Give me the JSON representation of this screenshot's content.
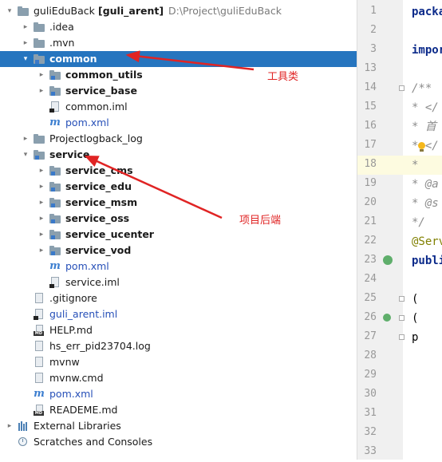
{
  "tree": {
    "rows": [
      {
        "level": 0,
        "arrow": "▾",
        "icon": "folder",
        "label": "guliEduBack",
        "extra_module": "[guli_arent]",
        "extra_path": "D:\\Project\\guliEduBack",
        "bold": false,
        "blue": false
      },
      {
        "level": 1,
        "arrow": "▸",
        "icon": "folder",
        "label": ".idea",
        "bold": false,
        "blue": false
      },
      {
        "level": 1,
        "arrow": "▸",
        "icon": "folder",
        "label": ".mvn",
        "bold": false,
        "blue": false
      },
      {
        "level": 1,
        "arrow": "▾",
        "icon": "module-folder",
        "label": "common",
        "bold": true,
        "blue": false,
        "selected": true
      },
      {
        "level": 2,
        "arrow": "▸",
        "icon": "module-folder",
        "label": "common_utils",
        "bold": true,
        "blue": false
      },
      {
        "level": 2,
        "arrow": "▸",
        "icon": "module-folder",
        "label": "service_base",
        "bold": true,
        "blue": false
      },
      {
        "level": 2,
        "arrow": "",
        "icon": "iml-file",
        "label": "common.iml",
        "bold": false,
        "blue": false
      },
      {
        "level": 2,
        "arrow": "",
        "icon": "maven",
        "label": "pom.xml",
        "bold": false,
        "blue": true
      },
      {
        "level": 1,
        "arrow": "▸",
        "icon": "folder",
        "label": "Projectlogback_log",
        "bold": false,
        "blue": false
      },
      {
        "level": 1,
        "arrow": "▾",
        "icon": "module-folder",
        "label": "service",
        "bold": true,
        "blue": false
      },
      {
        "level": 2,
        "arrow": "▸",
        "icon": "module-folder",
        "label": "service_cms",
        "bold": true,
        "blue": false
      },
      {
        "level": 2,
        "arrow": "▸",
        "icon": "module-folder",
        "label": "service_edu",
        "bold": true,
        "blue": false
      },
      {
        "level": 2,
        "arrow": "▸",
        "icon": "module-folder",
        "label": "service_msm",
        "bold": true,
        "blue": false
      },
      {
        "level": 2,
        "arrow": "▸",
        "icon": "module-folder",
        "label": "service_oss",
        "bold": true,
        "blue": false
      },
      {
        "level": 2,
        "arrow": "▸",
        "icon": "module-folder",
        "label": "service_ucenter",
        "bold": true,
        "blue": false
      },
      {
        "level": 2,
        "arrow": "▸",
        "icon": "module-folder",
        "label": "service_vod",
        "bold": true,
        "blue": false
      },
      {
        "level": 2,
        "arrow": "",
        "icon": "maven",
        "label": "pom.xml",
        "bold": false,
        "blue": true
      },
      {
        "level": 2,
        "arrow": "",
        "icon": "iml-file",
        "label": "service.iml",
        "bold": false,
        "blue": false
      },
      {
        "level": 1,
        "arrow": "",
        "icon": "file",
        "label": ".gitignore",
        "bold": false,
        "blue": false
      },
      {
        "level": 1,
        "arrow": "",
        "icon": "iml-file",
        "label": "guli_arent.iml",
        "bold": false,
        "blue": true
      },
      {
        "level": 1,
        "arrow": "",
        "icon": "md-file",
        "label": "HELP.md",
        "bold": false,
        "blue": false
      },
      {
        "level": 1,
        "arrow": "",
        "icon": "file",
        "label": "hs_err_pid23704.log",
        "bold": false,
        "blue": false
      },
      {
        "level": 1,
        "arrow": "",
        "icon": "file",
        "label": "mvnw",
        "bold": false,
        "blue": false
      },
      {
        "level": 1,
        "arrow": "",
        "icon": "file",
        "label": "mvnw.cmd",
        "bold": false,
        "blue": false
      },
      {
        "level": 1,
        "arrow": "",
        "icon": "maven",
        "label": "pom.xml",
        "bold": false,
        "blue": true
      },
      {
        "level": 1,
        "arrow": "",
        "icon": "md-file",
        "label": "READEME.md",
        "bold": false,
        "blue": false
      },
      {
        "level": 0,
        "arrow": "▸",
        "icon": "libraries",
        "label": "External Libraries",
        "bold": false,
        "blue": false
      },
      {
        "level": 0,
        "arrow": "",
        "icon": "scratches",
        "label": "Scratches and Consoles",
        "bold": false,
        "blue": false
      }
    ]
  },
  "annotations": {
    "common_note": "工具类",
    "service_note": "项目后端"
  },
  "editor": {
    "line_numbers": [
      "1",
      "2",
      "3",
      "13",
      "14",
      "15",
      "16",
      "17",
      "18",
      "19",
      "20",
      "21",
      "22",
      "23",
      "24",
      "25",
      "26",
      "27",
      "28",
      "29",
      "30",
      "31",
      "32",
      "33"
    ],
    "code": [
      "packa",
      "",
      "impor",
      "",
      "/**",
      " * </",
      " * 首",
      " * </",
      " *",
      " * @a",
      " * @s",
      " */",
      "@Serv",
      "publi",
      "",
      "   (",
      "   (",
      "   p",
      "",
      "",
      "",
      "",
      "",
      ""
    ],
    "current_line_index": 8
  },
  "colors": {
    "selection": "#2675bf",
    "annotation": "#e02424",
    "module_icon": "#3a79c9"
  }
}
